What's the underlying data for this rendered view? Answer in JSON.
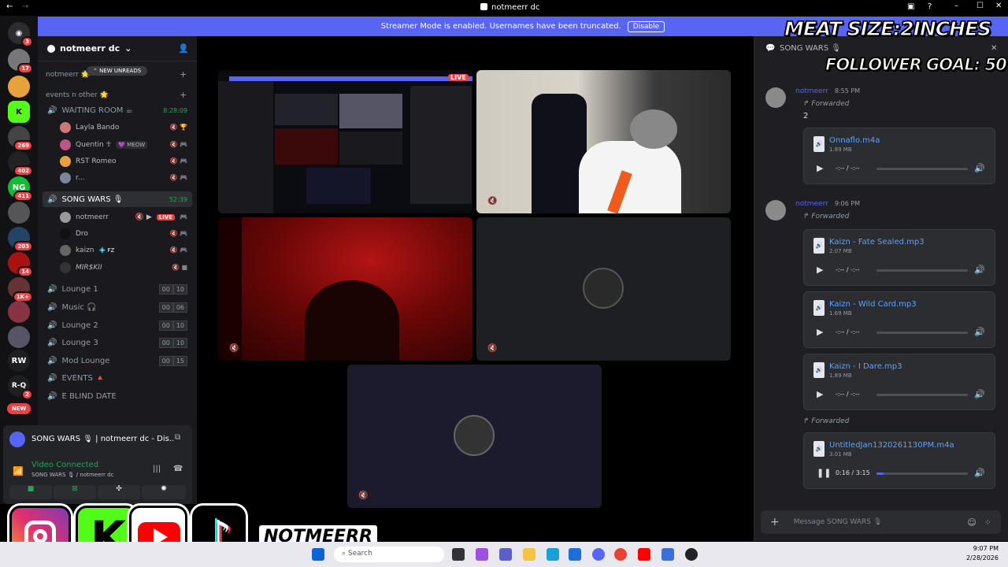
{
  "window": {
    "title": "notmeerr dc"
  },
  "banner": {
    "text": "Streamer Mode is enabled. Usernames have been truncated.",
    "button": "Disable"
  },
  "guilds": [
    {
      "badge": "3"
    },
    {
      "badge": "17"
    },
    {
      "badge": ""
    },
    {
      "badge": ""
    },
    {
      "badge": "269"
    },
    {
      "badge": "402"
    },
    {
      "badge": "411"
    },
    {
      "badge": ""
    },
    {
      "badge": "203"
    },
    {
      "badge": "14"
    },
    {
      "badge": "1K+"
    },
    {
      "badge": ""
    },
    {
      "badge": ""
    },
    {
      "label": "RW"
    },
    {
      "label": "R-Q",
      "badge": "2"
    },
    {
      "label": "NEW"
    }
  ],
  "server": {
    "name": "notmeerr dc"
  },
  "channels": {
    "cat1": "notmeerr 🌟",
    "new_unreads": "NEW UNREADS",
    "cat2": "events n other 🌟",
    "waiting": {
      "name": "WAITING ROOM ☕",
      "time": "8:28:09"
    },
    "waiting_members": [
      "Layla Bando",
      "Quentin ☥",
      "RST Romeo",
      "r..."
    ],
    "meow_tag": "💜 MEOW",
    "songwars": {
      "name": "SONG WARS 🎙",
      "time": "52:39"
    },
    "song_members": [
      "notmeerr",
      "Dro",
      "kaizn",
      "MIR$KII"
    ],
    "live": "LIVE",
    "fz_tag": "💠 FZ",
    "voice": [
      {
        "name": "Lounge 1",
        "a": "00",
        "b": "10"
      },
      {
        "name": "Music 🎧",
        "a": "00",
        "b": "06"
      },
      {
        "name": "Lounge 2",
        "a": "00",
        "b": "10"
      },
      {
        "name": "Lounge 3",
        "a": "00",
        "b": "10"
      },
      {
        "name": "Mod Lounge",
        "a": "00",
        "b": "15"
      }
    ],
    "events": "EVENTS 🔺",
    "blind": "E BLIND DATE"
  },
  "voice_panel": {
    "activity": "SONG WARS 🎙 | notmeerr dc - Dis...",
    "status": "Video Connected",
    "sub": "SONG WARS 🎙 / notmeerr dc"
  },
  "stage": {
    "live": "LIVE"
  },
  "chat": {
    "channel": "SONG WARS 🎙",
    "overlay1": "MEAT SIZE:2INCHES",
    "overlay2": "FOLLOWER GOAL: 50",
    "msgs": [
      {
        "author": "notmeerr",
        "time": "8:55 PM",
        "forwarded": "Forwarded",
        "text": "2"
      },
      {
        "author": "notmeerr",
        "time": "9:06 PM",
        "forwarded": "Forwarded"
      }
    ],
    "files": [
      {
        "name": "Onnaflo.m4a",
        "size": "1.89 MB",
        "time": "-:-- / -:--",
        "progress": 0
      },
      {
        "name": "Kaizn - Fate Sealed.mp3",
        "size": "2.07 MB",
        "time": "-:-- / -:--",
        "progress": 0
      },
      {
        "name": "Kaizn - Wild Card.mp3",
        "size": "1.69 MB",
        "time": "-:-- / -:--",
        "progress": 0
      },
      {
        "name": "Kaizn - I Dare.mp3",
        "size": "1.89 MB",
        "time": "-:-- / -:--",
        "progress": 0
      },
      {
        "name": "UntitledJan1320261130PM.m4a",
        "size": "3.01 MB",
        "time": "0:16 / 3:15",
        "progress": 0.08
      }
    ],
    "forwarded3": "Forwarded",
    "placeholder": "Message SONG WARS 🎙"
  },
  "stream_overlay": {
    "handle": "NOTMEERR"
  },
  "taskbar": {
    "search": "Search",
    "clock_time": "9:07 PM",
    "clock_date": "2/28/2026"
  }
}
